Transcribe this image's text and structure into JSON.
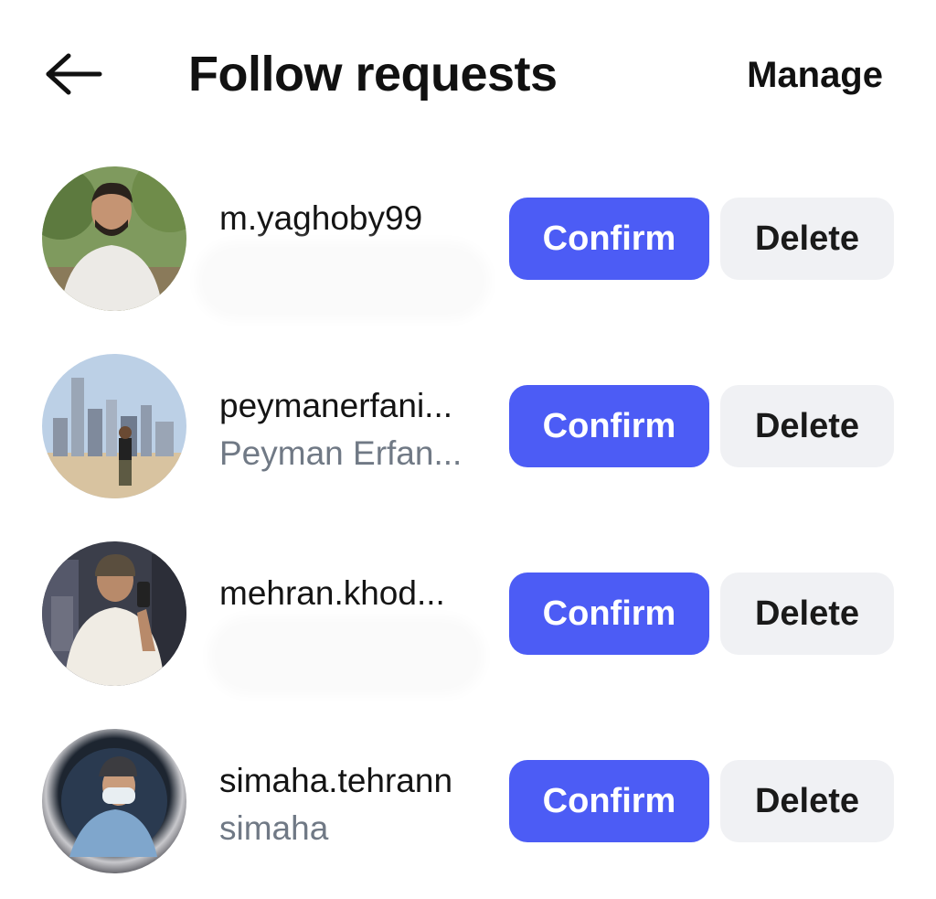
{
  "header": {
    "title": "Follow requests",
    "manage_label": "Manage",
    "back_icon": "arrow-left-icon"
  },
  "colors": {
    "confirm_bg": "#4c5cf5",
    "delete_bg": "#f0f1f4",
    "secondary_text": "#707985"
  },
  "requests": [
    {
      "username": "m.yaghoby99",
      "full_name": "",
      "confirm_label": "Confirm",
      "delete_label": "Delete"
    },
    {
      "username": "peymanerfani...",
      "full_name": "Peyman Erfan...",
      "confirm_label": "Confirm",
      "delete_label": "Delete"
    },
    {
      "username": "mehran.khod...",
      "full_name": "",
      "confirm_label": "Confirm",
      "delete_label": "Delete"
    },
    {
      "username": "simaha.tehrann",
      "full_name": "simaha",
      "confirm_label": "Confirm",
      "delete_label": "Delete"
    }
  ]
}
